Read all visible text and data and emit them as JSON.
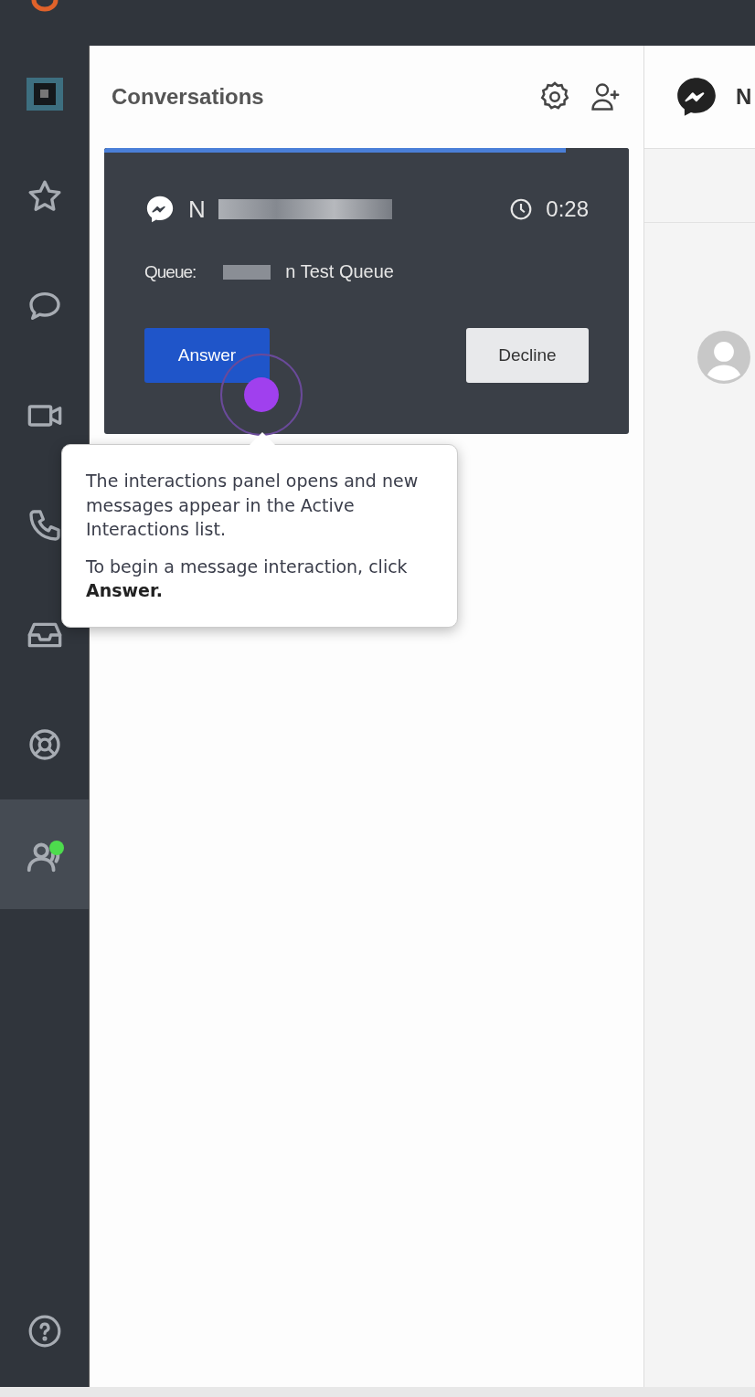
{
  "sidebar": {
    "items": [
      {
        "kind": "star",
        "selected": false,
        "badge": false
      },
      {
        "kind": "chat",
        "selected": false,
        "badge": false
      },
      {
        "kind": "video",
        "selected": false,
        "badge": false
      },
      {
        "kind": "phone",
        "selected": false,
        "badge": false
      },
      {
        "kind": "inbox",
        "selected": false,
        "badge": false
      },
      {
        "kind": "lifebuoy",
        "selected": false,
        "badge": false
      },
      {
        "kind": "agent",
        "selected": true,
        "badge": true
      }
    ]
  },
  "conversations": {
    "title": "Conversations",
    "card": {
      "name": "N",
      "timer": "0:28",
      "queue_label": "Queue:",
      "queue": "n Test Queue",
      "level": 0.88,
      "answer": "Answer",
      "decline": "Decline"
    }
  },
  "tooltip": {
    "paragraphs": [
      "The interactions panel opens and new messages appear in the Active Interactions list.",
      "To begin a message interaction, click **Answer.**"
    ]
  },
  "detail": {
    "header": "N"
  }
}
